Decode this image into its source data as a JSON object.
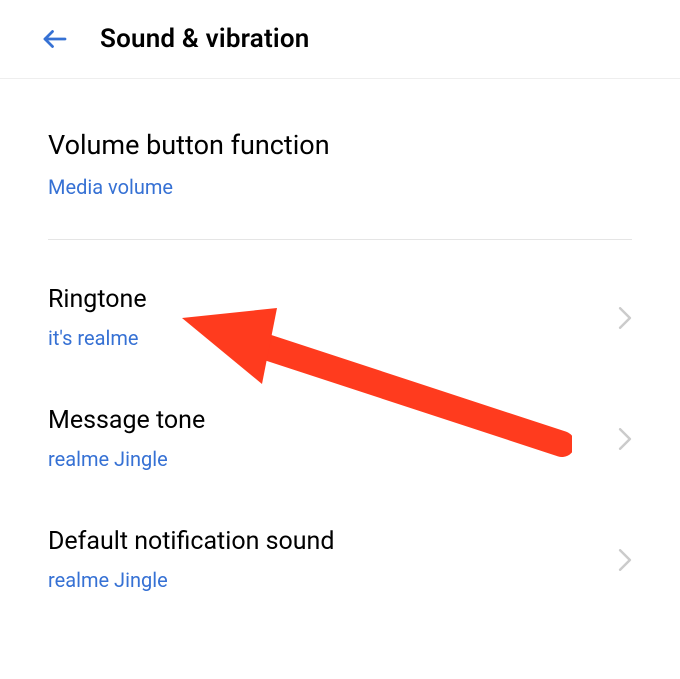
{
  "header": {
    "title": "Sound & vibration"
  },
  "volume_section": {
    "label": "Volume button function",
    "value": "Media volume"
  },
  "settings": [
    {
      "label": "Ringtone",
      "value": "it's realme"
    },
    {
      "label": "Message tone",
      "value": "realme Jingle"
    },
    {
      "label": "Default notification sound",
      "value": "realme Jingle"
    }
  ]
}
